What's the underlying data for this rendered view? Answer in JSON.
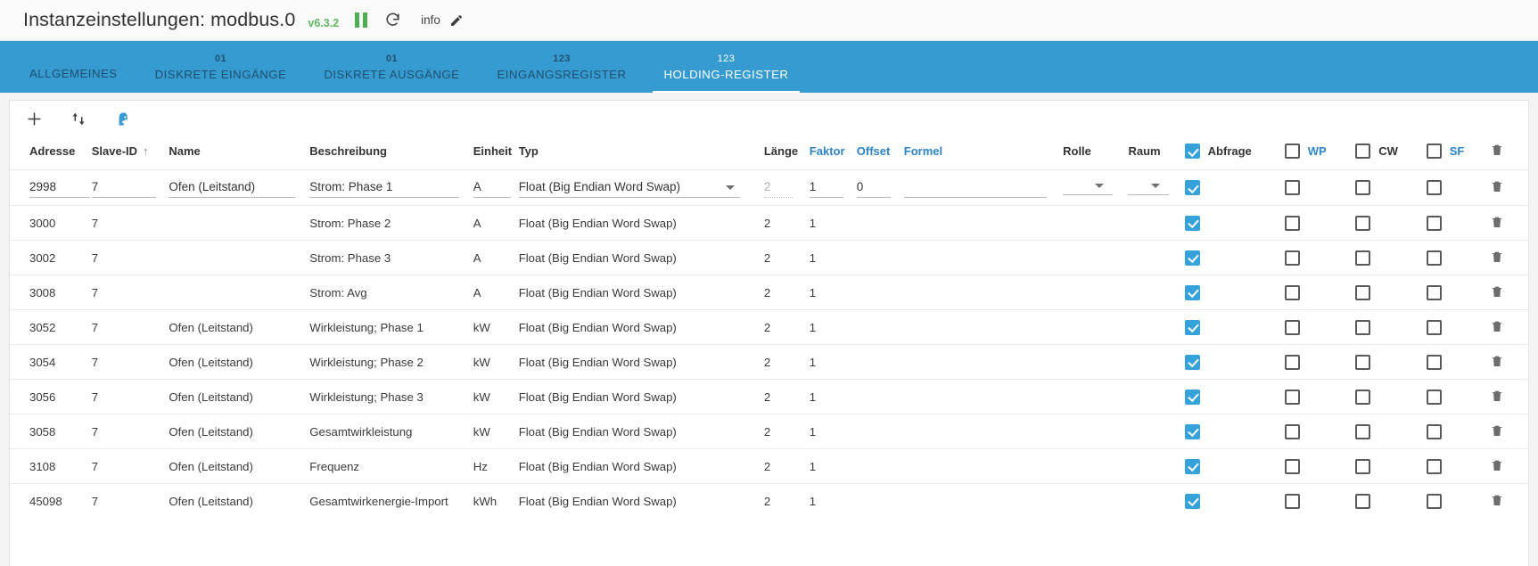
{
  "header": {
    "title": "Instanzeinstellungen: modbus.0",
    "version": "v6.3.2",
    "info_label": "info",
    "icons": {
      "pause": "pause-icon",
      "refresh": "refresh-icon",
      "edit": "edit-pencil-icon"
    },
    "accent": "#359bd1",
    "version_color": "#5fb760"
  },
  "tabs": [
    {
      "num": "",
      "label": "ALLGEMEINES",
      "active": false
    },
    {
      "num": "01",
      "label": "DISKRETE EINGÄNGE",
      "active": false
    },
    {
      "num": "01",
      "label": "DISKRETE AUSGÄNGE",
      "active": false
    },
    {
      "num": "123",
      "label": "EINGANGSREGISTER",
      "active": false
    },
    {
      "num": "123",
      "label": "HOLDING-REGISTER",
      "active": true
    }
  ],
  "toolbar": {
    "add_label": "+",
    "sort_label": "import-export",
    "person_label": "person-head"
  },
  "table": {
    "columns": [
      {
        "key": "adresse",
        "label": "Adresse",
        "blue": false,
        "sorted": false
      },
      {
        "key": "slave",
        "label": "Slave-ID",
        "blue": false,
        "sorted": true
      },
      {
        "key": "name",
        "label": "Name",
        "blue": false,
        "sorted": false
      },
      {
        "key": "besch",
        "label": "Beschreibung",
        "blue": false,
        "sorted": false
      },
      {
        "key": "einheit",
        "label": "Einheit",
        "blue": false,
        "sorted": false
      },
      {
        "key": "typ",
        "label": "Typ",
        "blue": false,
        "sorted": false
      },
      {
        "key": "laenge",
        "label": "Länge",
        "blue": false,
        "sorted": false
      },
      {
        "key": "faktor",
        "label": "Faktor",
        "blue": true,
        "sorted": false
      },
      {
        "key": "offset",
        "label": "Offset",
        "blue": true,
        "sorted": false
      },
      {
        "key": "formel",
        "label": "Formel",
        "blue": true,
        "sorted": false
      },
      {
        "key": "rolle",
        "label": "Rolle",
        "blue": false,
        "sorted": false
      },
      {
        "key": "raum",
        "label": "Raum",
        "blue": false,
        "sorted": false
      },
      {
        "key": "abfrage",
        "label": "Abfrage",
        "blue": false,
        "checkbox": true,
        "checked": true
      },
      {
        "key": "wp",
        "label": "WP",
        "blue": true,
        "checkbox": true,
        "checked": false
      },
      {
        "key": "cw",
        "label": "CW",
        "blue": false,
        "checkbox": true,
        "checked": false
      },
      {
        "key": "sf",
        "label": "SF",
        "blue": true,
        "checkbox": true,
        "checked": false
      },
      {
        "key": "delete",
        "label": "",
        "blue": false,
        "icon": "trash-icon"
      }
    ],
    "sort_arrow": "↑",
    "edit_row": {
      "adresse": "2998",
      "slave": "7",
      "name": "Ofen (Leitstand)",
      "beschreibung": "Strom: Phase 1",
      "einheit": "A",
      "typ": "Float (Big Endian Word Swap)",
      "laenge": "2",
      "faktor": "1",
      "offset": "0",
      "formel": "",
      "rolle": "",
      "raum": "",
      "abfrage": true,
      "wp": false,
      "cw": false,
      "sf": false
    },
    "rows": [
      {
        "adresse": "3000",
        "slave": "7",
        "name": "",
        "beschreibung": "Strom: Phase 2",
        "einheit": "A",
        "typ": "Float (Big Endian Word Swap)",
        "laenge": "2",
        "faktor": "1",
        "offset": "",
        "formel": "",
        "rolle": "",
        "raum": "",
        "abfrage": true,
        "wp": false,
        "cw": false,
        "sf": false
      },
      {
        "adresse": "3002",
        "slave": "7",
        "name": "",
        "beschreibung": "Strom: Phase 3",
        "einheit": "A",
        "typ": "Float (Big Endian Word Swap)",
        "laenge": "2",
        "faktor": "1",
        "offset": "",
        "formel": "",
        "rolle": "",
        "raum": "",
        "abfrage": true,
        "wp": false,
        "cw": false,
        "sf": false
      },
      {
        "adresse": "3008",
        "slave": "7",
        "name": "",
        "beschreibung": "Strom: Avg",
        "einheit": "A",
        "typ": "Float (Big Endian Word Swap)",
        "laenge": "2",
        "faktor": "1",
        "offset": "",
        "formel": "",
        "rolle": "",
        "raum": "",
        "abfrage": true,
        "wp": false,
        "cw": false,
        "sf": false
      },
      {
        "adresse": "3052",
        "slave": "7",
        "name": "Ofen (Leitstand)",
        "beschreibung": "Wirkleistung; Phase 1",
        "einheit": "kW",
        "typ": "Float (Big Endian Word Swap)",
        "laenge": "2",
        "faktor": "1",
        "offset": "",
        "formel": "",
        "rolle": "",
        "raum": "",
        "abfrage": true,
        "wp": false,
        "cw": false,
        "sf": false
      },
      {
        "adresse": "3054",
        "slave": "7",
        "name": "Ofen (Leitstand)",
        "beschreibung": "Wirkleistung; Phase 2",
        "einheit": "kW",
        "typ": "Float (Big Endian Word Swap)",
        "laenge": "2",
        "faktor": "1",
        "offset": "",
        "formel": "",
        "rolle": "",
        "raum": "",
        "abfrage": true,
        "wp": false,
        "cw": false,
        "sf": false
      },
      {
        "adresse": "3056",
        "slave": "7",
        "name": "Ofen (Leitstand)",
        "beschreibung": "Wirkleistung; Phase 3",
        "einheit": "kW",
        "typ": "Float (Big Endian Word Swap)",
        "laenge": "2",
        "faktor": "1",
        "offset": "",
        "formel": "",
        "rolle": "",
        "raum": "",
        "abfrage": true,
        "wp": false,
        "cw": false,
        "sf": false
      },
      {
        "adresse": "3058",
        "slave": "7",
        "name": "Ofen (Leitstand)",
        "beschreibung": "Gesamtwirkleistung",
        "einheit": "kW",
        "typ": "Float (Big Endian Word Swap)",
        "laenge": "2",
        "faktor": "1",
        "offset": "",
        "formel": "",
        "rolle": "",
        "raum": "",
        "abfrage": true,
        "wp": false,
        "cw": false,
        "sf": false
      },
      {
        "adresse": "3108",
        "slave": "7",
        "name": "Ofen (Leitstand)",
        "beschreibung": "Frequenz",
        "einheit": "Hz",
        "typ": "Float (Big Endian Word Swap)",
        "laenge": "2",
        "faktor": "1",
        "offset": "",
        "formel": "",
        "rolle": "",
        "raum": "",
        "abfrage": true,
        "wp": false,
        "cw": false,
        "sf": false
      },
      {
        "adresse": "45098",
        "slave": "7",
        "name": "Ofen (Leitstand)",
        "beschreibung": "Gesamtwirkenergie-Import",
        "einheit": "kWh",
        "typ": "Float (Big Endian Word Swap)",
        "laenge": "2",
        "faktor": "1",
        "offset": "",
        "formel": "",
        "rolle": "",
        "raum": "",
        "abfrage": true,
        "wp": false,
        "cw": false,
        "sf": false
      }
    ]
  }
}
